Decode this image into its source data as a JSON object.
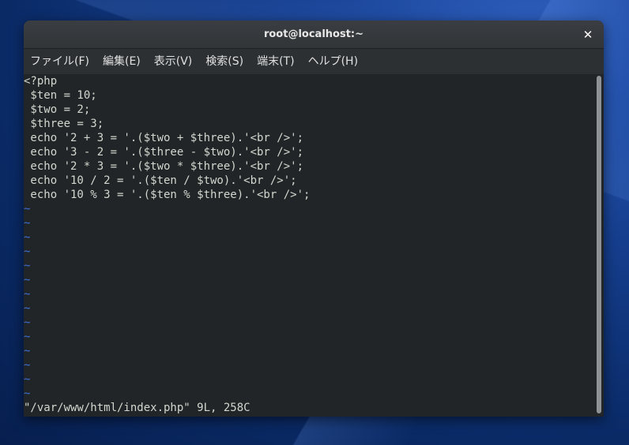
{
  "window": {
    "title": "root@localhost:~",
    "close_label": "✕"
  },
  "menubar": {
    "items": [
      {
        "label": "ファイル(F)"
      },
      {
        "label": "編集(E)"
      },
      {
        "label": "表示(V)"
      },
      {
        "label": "検索(S)"
      },
      {
        "label": "端末(T)"
      },
      {
        "label": "ヘルプ(H)"
      }
    ]
  },
  "terminal": {
    "lines": [
      "<?php",
      " $ten = 10;",
      " $two = 2;",
      " $three = 3;",
      " echo '2 + 3 = '.($two + $three).'<br />';",
      " echo '3 - 2 = '.($three - $two).'<br />';",
      " echo '2 * 3 = '.($two * $three).'<br />';",
      " echo '10 / 2 = '.($ten / $two).'<br />';",
      " echo '10 % 3 = '.($ten % $three).'<br />';"
    ],
    "empty_line_marker": "~",
    "empty_line_count": 14,
    "status": "\"/var/www/html/index.php\" 9L, 258C"
  },
  "colors": {
    "terminal_bg": "#222527",
    "text": "#d3d7cf",
    "tilde": "#3d6fd8",
    "titlebar": "#35383b"
  }
}
